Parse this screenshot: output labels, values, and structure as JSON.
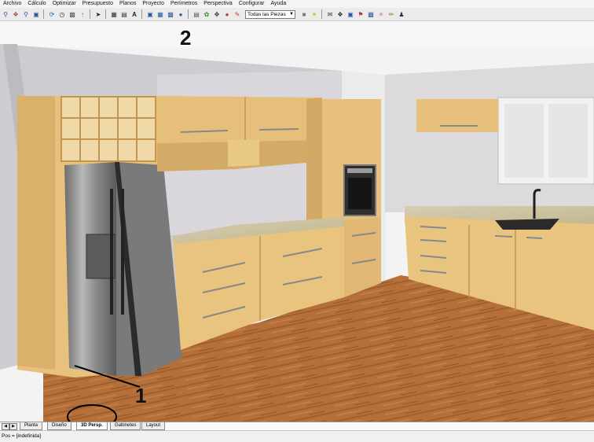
{
  "menu": [
    "Archivo",
    "Cálculo",
    "Optimizar",
    "Presupuesto",
    "Planos",
    "Proyecto",
    "Perímetros",
    "Perspectiva",
    "Configurar",
    "Ayuda"
  ],
  "toolbar": {
    "icons_group1": [
      "zoom-in-icon",
      "zoom-extents-icon",
      "zoom-out-icon",
      "zoom-window-icon"
    ],
    "icons_group2": [
      "refresh-icon",
      "clock-icon",
      "camera-icon",
      "arrow-icon"
    ],
    "icons_group3": [
      "select-icon"
    ],
    "icons_group4": [
      "grid-icon",
      "document-icon",
      "text-icon"
    ],
    "icons_group5": [
      "image-icon",
      "layers-icon",
      "render-icon",
      "sphere-icon"
    ],
    "icons_group6": [
      "wall-icon",
      "render-scene-icon",
      "move-icon",
      "paint-icon",
      "pencil-icon"
    ],
    "pieces_filter": "Todas las Piezas",
    "icons_group7": [
      "square-icon",
      "lightbulb-icon",
      "mail-icon",
      "twitter-icon",
      "share-icon",
      "flag-icon",
      "palette-icon",
      "magic-wand-icon",
      "users-icon"
    ]
  },
  "annotations": {
    "label_1": "1",
    "label_2": "2"
  },
  "tabs": [
    {
      "label": "Planta"
    },
    {
      "label": "Diseño"
    },
    {
      "label": "3D Persp."
    },
    {
      "label": "Gabinetes"
    },
    {
      "label": "Layout"
    }
  ],
  "active_tab": "3D Persp.",
  "status": {
    "text": "Pos = [indefinida]"
  }
}
